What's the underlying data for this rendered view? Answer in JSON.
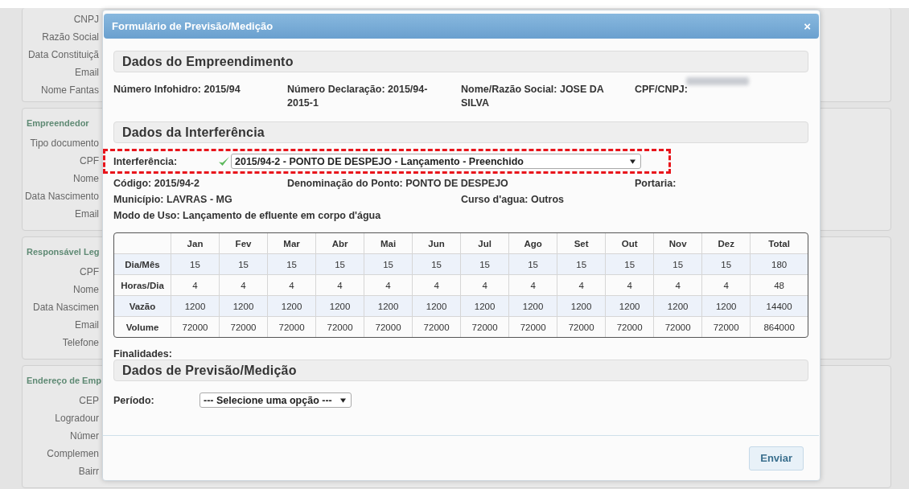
{
  "background_panels": [
    {
      "fields": [
        "CNPJ",
        "Razão Social",
        "Data Constituiçã",
        "Email",
        "Nome Fantas"
      ]
    },
    {
      "heading": "Empreendedor",
      "fields": [
        "Tipo documento",
        "CPF",
        "Nome",
        "Data Nascimento",
        "Email"
      ]
    },
    {
      "heading": "Responsável Leg",
      "fields": [
        "CPF",
        "Nome",
        "Data Nascimen",
        "Email",
        "Telefone"
      ]
    },
    {
      "heading": "Endereço de Emp",
      "fields": [
        "CEP",
        "Logradour",
        "Númer",
        "Complemen",
        "Bairr"
      ]
    }
  ],
  "dialog": {
    "title": "Formulário de Previsão/Medição",
    "close": "×",
    "section_1": {
      "title": "Dados do Empreendimento",
      "fields": [
        "Número Infohidro: 2015/94",
        "Número Declaração: 2015/94-2015-1",
        "Nome/Razão Social: JOSE DA SILVA",
        "CPF/CNPJ:"
      ]
    },
    "section_2": {
      "title": "Dados da Interferência",
      "interference": {
        "label": "Interferência:",
        "valid": true,
        "value": "2015/94-2 - PONTO DE DESPEJO - Lançamento - Preenchido"
      },
      "details": [
        {
          "column_1": "Código: 2015/94-2",
          "column_2": "Denominação do Ponto: PONTO DE DESPEJO",
          "column_4": "Portaria:"
        },
        {
          "column_1": "Município: LAVRAS - MG",
          "column_3": "Curso d'agua: Outros"
        }
      ],
      "usage": "Modo de Uso: Lançamento de efluente em corpo d'água",
      "table": {
        "columns": [
          "Jan",
          "Fev",
          "Mar",
          "Abr",
          "Mai",
          "Jun",
          "Jul",
          "Ago",
          "Set",
          "Out",
          "Nov",
          "Dez",
          "Total"
        ],
        "rows": [
          {
            "label": "Dia/Mês",
            "values": [
              "15",
              "15",
              "15",
              "15",
              "15",
              "15",
              "15",
              "15",
              "15",
              "15",
              "15",
              "15",
              "180"
            ]
          },
          {
            "label": "Horas/Dia",
            "values": [
              "4",
              "4",
              "4",
              "4",
              "4",
              "4",
              "4",
              "4",
              "4",
              "4",
              "4",
              "4",
              "48"
            ]
          },
          {
            "label": "Vazão",
            "values": [
              "1200",
              "1200",
              "1200",
              "1200",
              "1200",
              "1200",
              "1200",
              "1200",
              "1200",
              "1200",
              "1200",
              "1200",
              "14400"
            ]
          },
          {
            "label": "Volume",
            "values": [
              "72000",
              "72000",
              "72000",
              "72000",
              "72000",
              "72000",
              "72000",
              "72000",
              "72000",
              "72000",
              "72000",
              "72000",
              "864000"
            ]
          }
        ]
      },
      "purposes": "Finalidades:"
    },
    "section_3": {
      "title": "Dados de Previsão/Medição",
      "period_label": "Período:",
      "period_placeholder": "--- Selecione uma opção ---"
    },
    "submit": "Enviar"
  }
}
